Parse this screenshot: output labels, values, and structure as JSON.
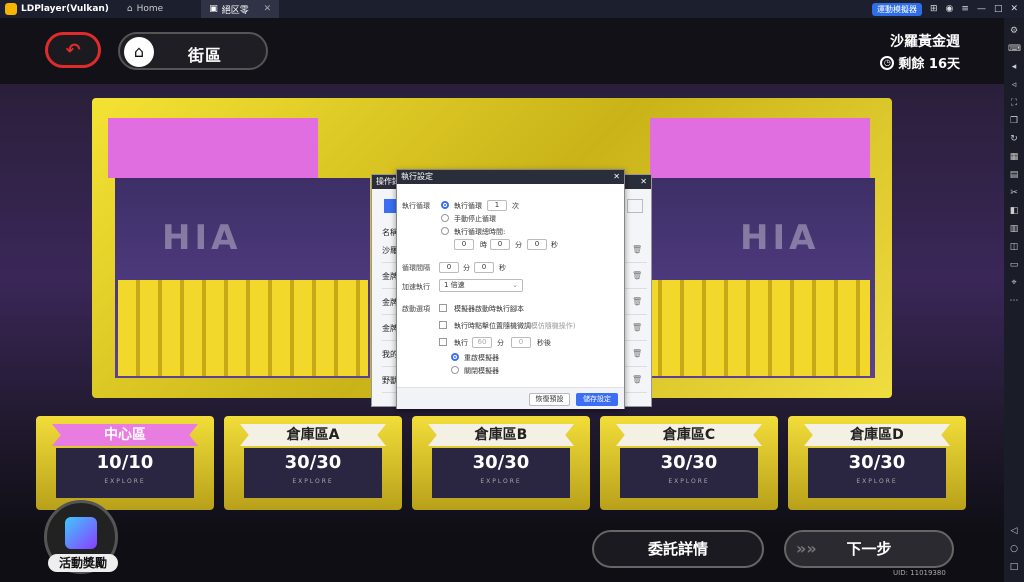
{
  "titlebar": {
    "app_title": "LDPlayer(Vulkan)",
    "home_tab": "Home",
    "game_tab": "絕区零",
    "speed_button": "運動模擬器"
  },
  "game": {
    "street_label": "街區",
    "event_title": "沙羅黃金週",
    "remaining": "剩餘 16天",
    "hia": "HIA",
    "zones": [
      {
        "label": "中心區",
        "count": "10/10",
        "explore": "EXPLORE"
      },
      {
        "label": "倉庫區A",
        "count": "30/30",
        "explore": "EXPLORE"
      },
      {
        "label": "倉庫區B",
        "count": "30/30",
        "explore": "EXPLORE"
      },
      {
        "label": "倉庫區C",
        "count": "30/30",
        "explore": "EXPLORE"
      },
      {
        "label": "倉庫區D",
        "count": "30/30",
        "explore": "EXPLORE"
      }
    ],
    "reward_label": "活動獎勵",
    "detail_button": "委託詳情",
    "next_button": "下一步",
    "uid": "UID: 11019380"
  },
  "dialog_back": {
    "title": "操作錄",
    "column_name": "名稱",
    "rows": [
      "沙羅",
      "金牌",
      "金牌",
      "金牌",
      "我的",
      "野獸"
    ]
  },
  "dialog_front": {
    "title": "執行設定",
    "loop_label": "執行循環",
    "loop_option": "執行循環",
    "loop_count": "1",
    "loop_unit": "次",
    "manual_stop": "手動停止循環",
    "total_time": "執行循環總時間:",
    "time_h": "0",
    "unit_h": "時",
    "time_m": "0",
    "unit_m": "分",
    "time_s": "0",
    "unit_s": "秒",
    "interval_label": "循環間隔",
    "interval_m": "0",
    "interval_s": "0",
    "speed_label": "加速執行",
    "speed_value": "1 倍速",
    "startup_label": "啟動選項",
    "opt_autorun": "模擬器啟動時執行腳本",
    "opt_random": "執行時點擊位置隨機微調",
    "opt_random_hint": "(模仿隨機操作)",
    "opt_exec": "執行",
    "exec_m": "60",
    "exec_s": "0",
    "exec_after": "秒後",
    "restart": "重啟模擬器",
    "close": "關閉模擬器",
    "reset_button": "恢復預設",
    "save_button": "儲存設定"
  }
}
